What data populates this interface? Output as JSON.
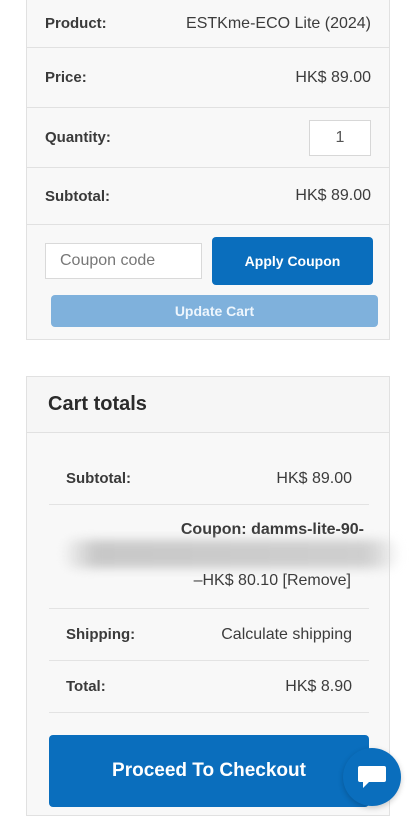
{
  "cart": {
    "product_label": "Product:",
    "product_value": "ESTKme-ECO Lite (2024)",
    "price_label": "Price:",
    "price_value": "HK$  89.00",
    "quantity_label": "Quantity:",
    "quantity_value": "1",
    "subtotal_label": "Subtotal:",
    "subtotal_value": "HK$  89.00",
    "coupon_placeholder": "Coupon code",
    "apply_coupon_label": "Apply Coupon",
    "update_cart_label": "Update Cart"
  },
  "totals": {
    "heading": "Cart totals",
    "subtotal_label": "Subtotal:",
    "subtotal_value": "HK$  89.00",
    "coupon_text": "Coupon: damms-lite-90-",
    "discount_text": "–HK$  80.10 [Remove]",
    "shipping_label": "Shipping:",
    "shipping_value": "Calculate shipping",
    "total_label": "Total:",
    "total_value": "HK$  8.90",
    "checkout_label": "Proceed To Checkout"
  },
  "colors": {
    "primary": "#0a6ebd",
    "disabled_button": "#7fb1dc",
    "panel_bg": "#f8f8f8",
    "border": "#e1e1e1"
  },
  "icons": {
    "chat": "chat-bubble-icon"
  }
}
